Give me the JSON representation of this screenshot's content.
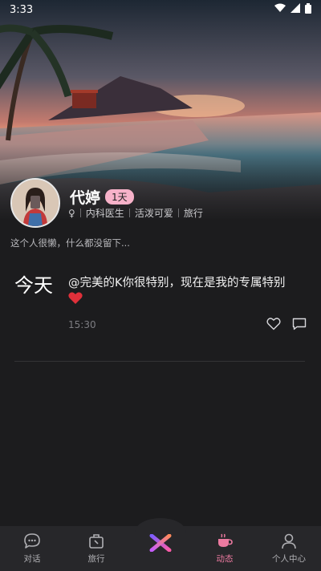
{
  "status_bar": {
    "time": "3:33"
  },
  "profile": {
    "name": "代婷",
    "badge": "1天",
    "gender_symbol": "♀",
    "tags": [
      "内科医生",
      "活泼可爱",
      "旅行"
    ],
    "bio": "这个人很懒，什么都没留下..."
  },
  "post": {
    "day": "今天",
    "text": "@完美的K你很特别，现在是我的专属特别",
    "time": "15:30"
  },
  "tabbar": {
    "items": [
      {
        "label": "对话",
        "icon": "chat-bubble-icon"
      },
      {
        "label": "旅行",
        "icon": "luggage-icon"
      },
      {
        "label": "",
        "icon": "x-logo-icon"
      },
      {
        "label": "动态",
        "icon": "coffee-cup-icon",
        "active": true
      },
      {
        "label": "个人中心",
        "icon": "person-icon"
      }
    ]
  },
  "colors": {
    "accent": "#ec7aa0",
    "badge_bg": "#f7b2c9",
    "background": "#1c1c1e"
  }
}
